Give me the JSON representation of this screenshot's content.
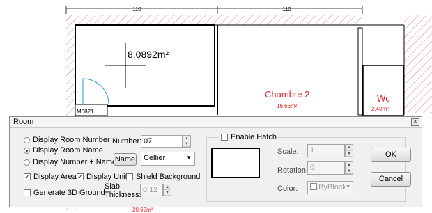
{
  "drawing": {
    "dim_left": "110",
    "dim_right": "110",
    "area_readout": "8.0892m²",
    "door_tag": "M0821",
    "room_name": "Chambre 2",
    "room_area": "16.66m²",
    "wc_name": "Wc",
    "wc_area": "2.40m²",
    "bottom_area": "20.62m²",
    "colors": {
      "room_text": "#e8242c",
      "wall": "#000000",
      "hatch": "#d98080",
      "door": "#1f9fcf"
    }
  },
  "dialog": {
    "title": "Room",
    "close_icon": "close-icon",
    "display_room_number": "Display Room Number",
    "display_room_name": "Display Room Name",
    "display_number_name": "Display Number + Name",
    "selected_display": "Display Room Name",
    "number_label": "Number:",
    "number_value": "07",
    "name_button": "Name",
    "name_value": "Cellier",
    "display_area": "Display Area",
    "display_area_checked": true,
    "display_unit": "Display Unit",
    "display_unit_checked": true,
    "shield_background": "Shield Background",
    "shield_background_checked": false,
    "generate_3d_ground": "Generate 3D Ground",
    "generate_3d_ground_checked": false,
    "slab_label_1": "Slab",
    "slab_label_2": "Thickness:",
    "slab_value": "0.12",
    "enable_hatch": "Enable Hatch",
    "enable_hatch_checked": false,
    "scale_label": "Scale:",
    "scale_value": "1",
    "rotation_label": "Rotation:",
    "rotation_value": "0",
    "color_label": "Color:",
    "color_value": "ByBlock",
    "ok_label": "OK",
    "cancel_label": "Cancel"
  }
}
